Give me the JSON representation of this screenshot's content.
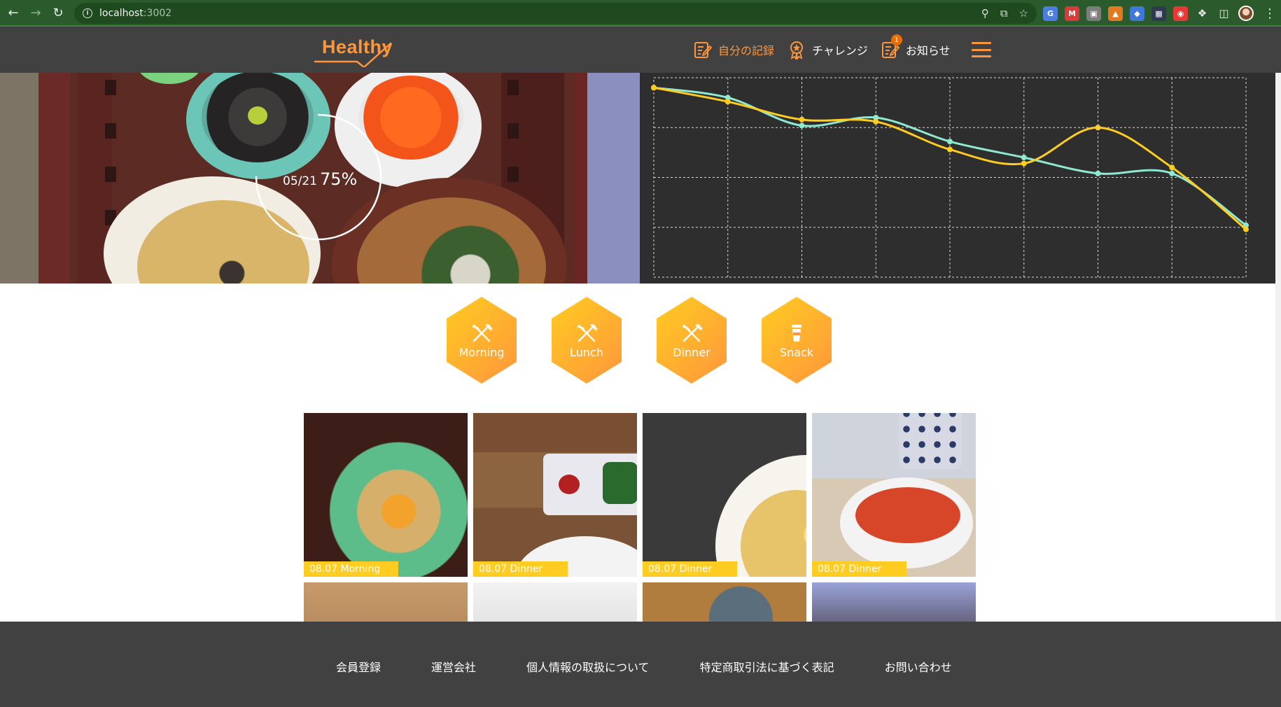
{
  "browser": {
    "url_host": "localhost",
    "url_port": ":3002"
  },
  "header": {
    "logo": "Healthy",
    "menu": [
      {
        "label": "自分の記録",
        "icon": "memo-icon",
        "active": true
      },
      {
        "label": "チャレンジ",
        "icon": "challenge-medal-icon",
        "active": false
      },
      {
        "label": "お知らせ",
        "icon": "info-memo-icon",
        "active": false,
        "badge": "1"
      }
    ],
    "hamburger": "hamburger-menu-icon"
  },
  "hero": {
    "date": "05/21",
    "percent": "75%",
    "progress_fraction": 0.75
  },
  "chart_data": {
    "type": "line",
    "title": "",
    "xlabel": "",
    "ylabel": "",
    "grid": true,
    "series": [
      {
        "color": "#8fe9d0",
        "values": [
          95,
          90,
          76,
          80,
          68,
          60,
          52,
          52,
          26
        ]
      },
      {
        "color": "#ffcc21",
        "values": [
          95,
          88,
          79,
          78,
          64,
          57,
          75,
          55,
          24
        ]
      }
    ],
    "ylim": [
      0,
      100
    ]
  },
  "meal_buttons": [
    {
      "label": "Morning",
      "icon": "knife-fork-icon"
    },
    {
      "label": "Lunch",
      "icon": "knife-fork-icon"
    },
    {
      "label": "Dinner",
      "icon": "knife-fork-icon"
    },
    {
      "label": "Snack",
      "icon": "cup-icon"
    }
  ],
  "gallery": [
    {
      "caption": "08.07 Morning"
    },
    {
      "caption": "08.07 Dinner"
    },
    {
      "caption": "08.07 Dinner"
    },
    {
      "caption": "08.07 Dinner"
    }
  ],
  "footer": {
    "links": [
      "会員登録",
      "運営会社",
      "個人情報の取扱について",
      "特定商取引法に基づく表記",
      "お問い合わせ"
    ]
  },
  "colors": {
    "primary_300": "#ffcc21",
    "primary_400": "#ff963c",
    "secondary_300": "#8fe9d0",
    "dark_500": "#414141",
    "dark_600": "#2e2e2e"
  }
}
